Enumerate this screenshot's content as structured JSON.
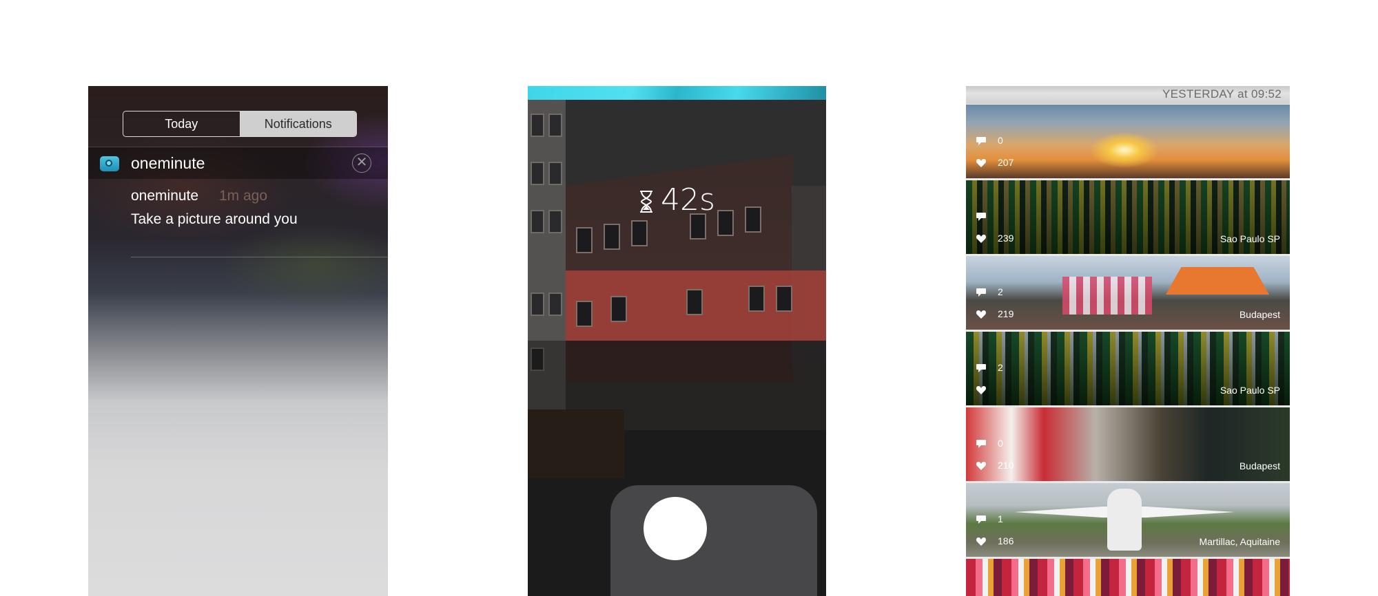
{
  "screen1": {
    "segment": {
      "today": "Today",
      "notifications": "Notifications"
    },
    "app_name": "oneminute",
    "close_icon": "close-circle-icon",
    "notification": {
      "title": "oneminute",
      "time": "1m ago",
      "body": "Take a picture around you"
    }
  },
  "screen2": {
    "timer": "42s",
    "timer_icon": "hourglass-icon",
    "shutter_icon": "shutter-button"
  },
  "screen3": {
    "header_date": "YESTERDAY at 09:52",
    "posts": [
      {
        "comments": "0",
        "likes": "207",
        "location": ""
      },
      {
        "comments": "",
        "likes": "239",
        "location": "Sao Paulo SP"
      },
      {
        "comments": "2",
        "likes": "219",
        "location": "Budapest"
      },
      {
        "comments": "2",
        "likes": "",
        "location": "Sao Paulo SP"
      },
      {
        "comments": "0",
        "likes": "210",
        "location": "Budapest"
      },
      {
        "comments": "1",
        "likes": "186",
        "location": "Martillac, Aquitaine"
      }
    ]
  }
}
